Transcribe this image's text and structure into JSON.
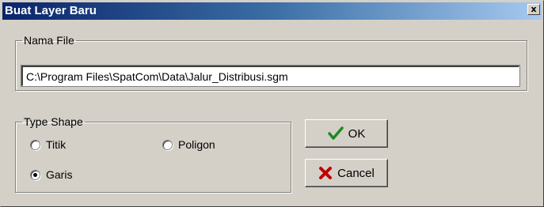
{
  "window": {
    "title": "Buat Layer Baru",
    "close_glyph": "x"
  },
  "nama_file": {
    "legend": "Nama File",
    "value": "C:\\Program Files\\SpatCom\\Data\\Jalur_Distribusi.sgm"
  },
  "type_shape": {
    "legend": "Type Shape",
    "options": [
      {
        "label": "Titik",
        "checked": false
      },
      {
        "label": "Poligon",
        "checked": false
      },
      {
        "label": "Garis",
        "checked": true
      }
    ]
  },
  "buttons": {
    "ok": {
      "label": "OK",
      "icon": "check-icon",
      "icon_color": "#1f8a1f"
    },
    "cancel": {
      "label": "Cancel",
      "icon": "x-icon",
      "icon_color": "#c00000"
    }
  }
}
